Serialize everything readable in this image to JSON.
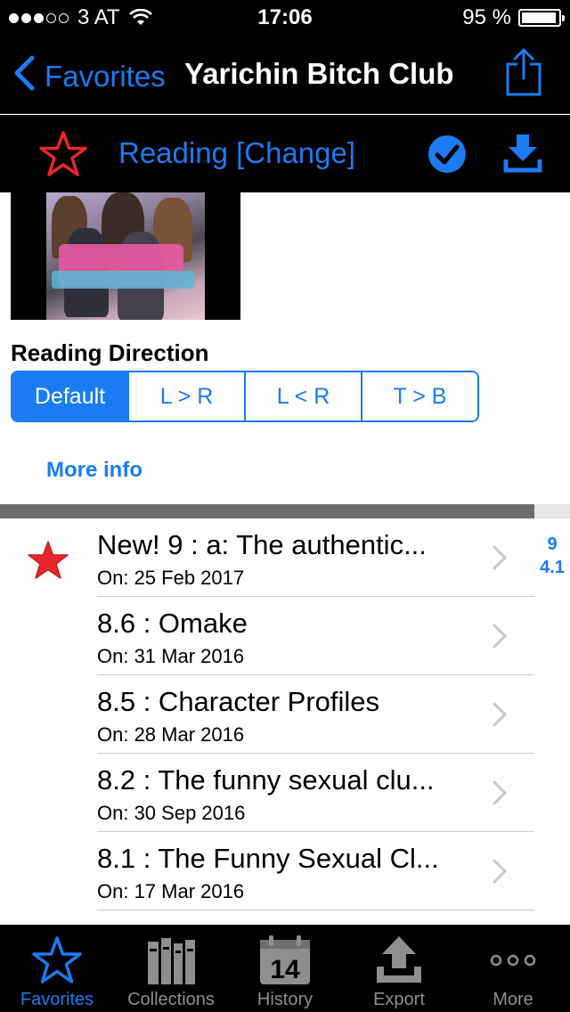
{
  "status_bar": {
    "carrier": "3 AT",
    "time": "17:06",
    "battery": "95 %",
    "battery_level": 0.95,
    "signal_bars": 3
  },
  "nav": {
    "back_label": "Favorites",
    "title": "Yarichin Bitch Club",
    "share_icon": "share-icon"
  },
  "reading_status": {
    "label": "Reading [Change]",
    "star_icon": "star-outline-icon",
    "check_icon": "checkmark-circle-icon",
    "download_icon": "download-icon"
  },
  "reading_direction": {
    "heading": "Reading Direction",
    "options": [
      "Default",
      "L > R",
      "L < R",
      "T > B"
    ],
    "selected": "Default"
  },
  "more_info": "More info",
  "chapters": [
    {
      "title": "New! 9 : a: The authentic...",
      "date": "On: 25 Feb 2017",
      "favorite": true
    },
    {
      "title": "8.6 : Omake",
      "date": "On: 31 Mar 2016",
      "favorite": false
    },
    {
      "title": "8.5 : Character Profiles",
      "date": "On: 28 Mar 2016",
      "favorite": false
    },
    {
      "title": "8.2 : The funny sexual clu...",
      "date": "On: 30 Sep 2016",
      "favorite": false
    },
    {
      "title": "8.1 : The Funny Sexual Cl...",
      "date": "On: 17 Mar 2016",
      "favorite": false
    }
  ],
  "side_index": [
    "9",
    "4.1"
  ],
  "tabs": [
    {
      "label": "Favorites",
      "icon": "star-icon",
      "active": true
    },
    {
      "label": "Collections",
      "icon": "books-icon",
      "active": false
    },
    {
      "label": "History",
      "icon": "calendar-icon",
      "calendar_day": "14",
      "active": false
    },
    {
      "label": "Export",
      "icon": "upload-icon",
      "active": false
    },
    {
      "label": "More",
      "icon": "more-dots-icon",
      "active": false
    }
  ],
  "colors": {
    "accent": "#1a7cf0",
    "star_red": "#e8262c",
    "bar_black": "#000000",
    "tab_inactive": "#8e8e8e"
  }
}
